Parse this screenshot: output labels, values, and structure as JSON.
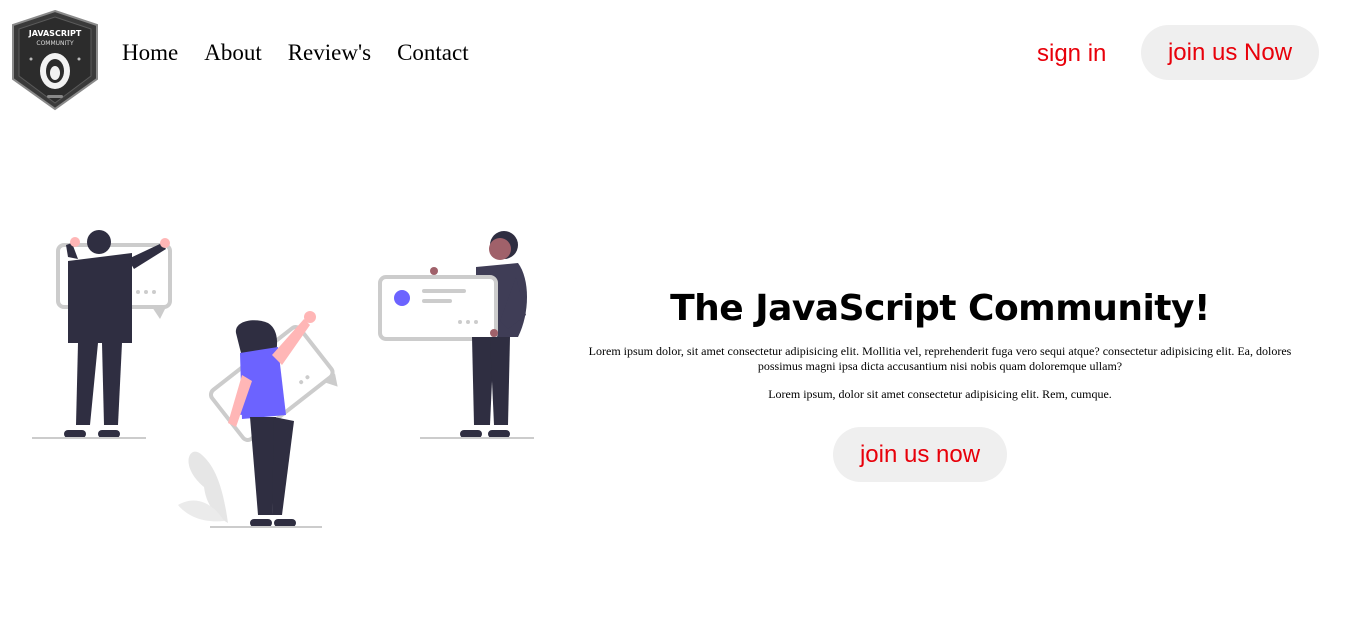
{
  "logo": {
    "text_top": "JAVASCRIPT",
    "text_bottom": "COMMUNITY",
    "icon": "lion-shield-logo"
  },
  "nav": {
    "items": [
      {
        "label": "Home"
      },
      {
        "label": "About"
      },
      {
        "label": "Review's"
      },
      {
        "label": "Contact"
      }
    ]
  },
  "header": {
    "signin_label": "sign in",
    "join_label": "join us Now"
  },
  "hero": {
    "title": "The JavaScript Community!",
    "paragraph1": "Lorem ipsum dolor, sit amet consectetur adipisicing elit. Mollitia vel, reprehenderit fuga vero sequi atque? consectetur adipisicing elit. Ea, dolores possimus magni ipsa dicta accusantium nisi nobis quam doloremque ullam?",
    "paragraph2": "Lorem ipsum, dolor sit amet consectetur adipisicing elit. Rem, cumque.",
    "cta_label": "join us now"
  },
  "illustration": {
    "icon": "people-with-chat-bubbles-illustration"
  },
  "colors": {
    "accent_red": "#e8000a",
    "button_bg": "#efefef",
    "illustration_purple": "#6c63ff",
    "illustration_dark": "#2f2e41",
    "illustration_gray": "#cccccc"
  }
}
